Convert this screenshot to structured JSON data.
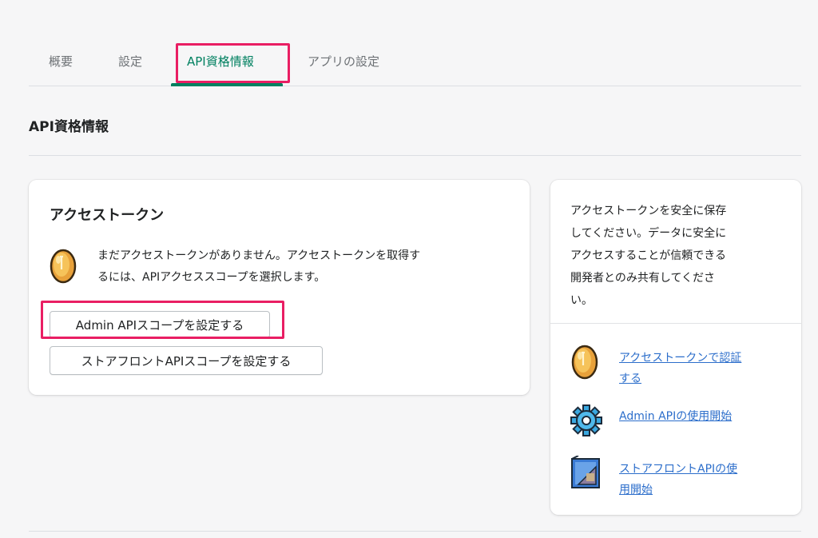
{
  "tabs": [
    {
      "label": "概要"
    },
    {
      "label": "設定"
    },
    {
      "label": "API資格情報"
    },
    {
      "label": "アプリの設定"
    }
  ],
  "section": {
    "title": "API資格情報"
  },
  "access_token_card": {
    "title": "アクセストークン",
    "message_line1": "まだアクセストークンがありません。アクセストークンを取得す",
    "message_line2": "るには、APIアクセススコープを選択します。",
    "admin_button_label": "Admin APIスコープを設定する",
    "storefront_button_label": "ストアフロントAPIスコープを設定する"
  },
  "side_card": {
    "text_lines": [
      "アクセストークンを安全に保存",
      "してください。データに安全に",
      "アクセスすることが信頼できる",
      "開発者とのみ共有してくださ",
      "い。"
    ],
    "links": [
      {
        "line1": "アクセストークンで認証",
        "line2": "する",
        "icon": "token-coin-icon"
      },
      {
        "line1": "Admin APIの使用開始",
        "line2": "",
        "icon": "gear-icon"
      },
      {
        "line1": "ストアフロントAPIの使",
        "line2": "用開始",
        "icon": "storefront-icon"
      }
    ]
  },
  "colors": {
    "accent": "#008060",
    "highlight": "#e91e63",
    "link": "#2c6ecb"
  }
}
